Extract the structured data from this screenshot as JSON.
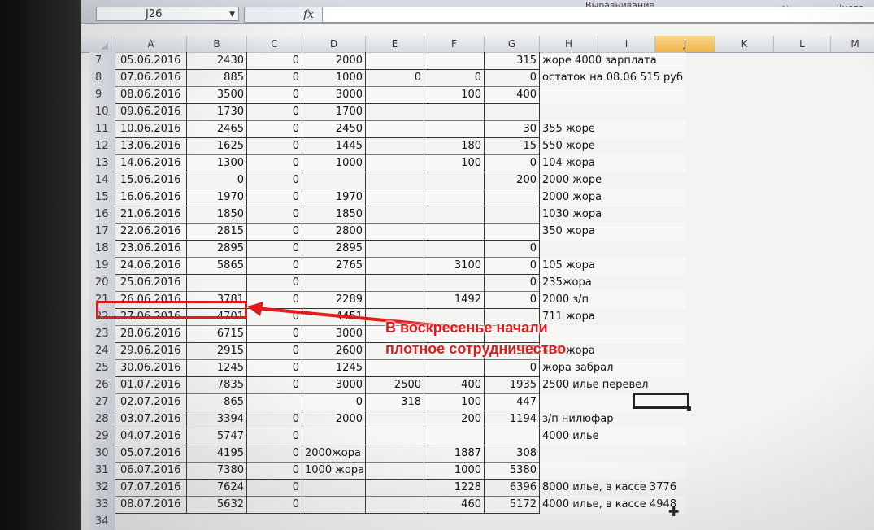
{
  "ribbon": {
    "alignment_label": "Выравнивание",
    "number_label": "Число"
  },
  "formula_bar": {
    "name_box": "J26",
    "fx_symbol": "fx",
    "formula": ""
  },
  "columns": [
    "A",
    "B",
    "C",
    "D",
    "E",
    "F",
    "G",
    "H",
    "I",
    "J",
    "K",
    "L",
    "M"
  ],
  "selected_column": "J",
  "rows": [
    {
      "num": "7",
      "A": "05.06.2016",
      "B": "2430",
      "C": "0",
      "D": "2000",
      "E": "",
      "F": "",
      "G": "315",
      "H": "жоре 4000 зарплата"
    },
    {
      "num": "8",
      "A": "07.06.2016",
      "B": "885",
      "C": "0",
      "D": "1000",
      "E": "0",
      "F": "0",
      "G": "0",
      "H": "остаток на 08.06 515 руб"
    },
    {
      "num": "9",
      "A": "08.06.2016",
      "B": "3500",
      "C": "0",
      "D": "3000",
      "E": "",
      "F": "100",
      "G": "400",
      "H": ""
    },
    {
      "num": "10",
      "A": "09.06.2016",
      "B": "1730",
      "C": "0",
      "D": "1700",
      "E": "",
      "F": "",
      "G": "",
      "H": ""
    },
    {
      "num": "11",
      "A": "10.06.2016",
      "B": "2465",
      "C": "0",
      "D": "2450",
      "E": "",
      "F": "",
      "G": "30",
      "H": "355 жоре"
    },
    {
      "num": "12",
      "A": "13.06.2016",
      "B": "1625",
      "C": "0",
      "D": "1445",
      "E": "",
      "F": "180",
      "G": "15",
      "H": "550 жоре"
    },
    {
      "num": "13",
      "A": "14.06.2016",
      "B": "1300",
      "C": "0",
      "D": "1000",
      "E": "",
      "F": "100",
      "G": "0",
      "H": "104 жора"
    },
    {
      "num": "14",
      "A": "15.06.2016",
      "B": "0",
      "C": "0",
      "D": "",
      "E": "",
      "F": "",
      "G": "200",
      "H": "2000 жоре"
    },
    {
      "num": "15",
      "A": "16.06.2016",
      "B": "1970",
      "C": "0",
      "D": "1970",
      "E": "",
      "F": "",
      "G": "",
      "H": "2000 жора"
    },
    {
      "num": "16",
      "A": "21.06.2016",
      "B": "1850",
      "C": "0",
      "D": "1850",
      "E": "",
      "F": "",
      "G": "",
      "H": "1030 жора"
    },
    {
      "num": "17",
      "A": "22.06.2016",
      "B": "2815",
      "C": "0",
      "D": "2800",
      "E": "",
      "F": "",
      "G": "",
      "H": "350 жора"
    },
    {
      "num": "18",
      "A": "23.06.2016",
      "B": "2895",
      "C": "0",
      "D": "2895",
      "E": "",
      "F": "",
      "G": "0",
      "H": ""
    },
    {
      "num": "19",
      "A": "24.06.2016",
      "B": "5865",
      "C": "0",
      "D": "2765",
      "E": "",
      "F": "3100",
      "G": "0",
      "H": "105 жора"
    },
    {
      "num": "20",
      "A": "25.06.2016",
      "B": "",
      "C": "0",
      "D": "",
      "E": "",
      "F": "",
      "G": "0",
      "H": "235жора"
    },
    {
      "num": "21",
      "A": "26.06.2016",
      "B": "3781",
      "C": "0",
      "D": "2289",
      "E": "",
      "F": "1492",
      "G": "0",
      "H": "2000 з/п"
    },
    {
      "num": "22",
      "A": "27.06.2016",
      "B": "4701",
      "C": "0",
      "D": "4451",
      "E": "",
      "F": "",
      "G": "",
      "H": "711 жора"
    },
    {
      "num": "23",
      "A": "28.06.2016",
      "B": "6715",
      "C": "0",
      "D": "3000",
      "E": "",
      "F": "",
      "G": "",
      "H": ""
    },
    {
      "num": "24",
      "A": "29.06.2016",
      "B": "2915",
      "C": "0",
      "D": "2600",
      "E": "",
      "F": "",
      "G": "315",
      "H": "400 жора"
    },
    {
      "num": "25",
      "A": "30.06.2016",
      "B": "1245",
      "C": "0",
      "D": "1245",
      "E": "",
      "F": "",
      "G": "0",
      "H": "жора забрал"
    },
    {
      "num": "26",
      "A": "01.07.2016",
      "B": "7835",
      "C": "0",
      "D": "3000",
      "E": "2500",
      "F": "400",
      "G": "1935",
      "H": "2500 илье перевел"
    },
    {
      "num": "27",
      "A": "02.07.2016",
      "B": "865",
      "C": "",
      "D": "0",
      "E": "318",
      "F": "100",
      "G": "447",
      "H": ""
    },
    {
      "num": "28",
      "A": "03.07.2016",
      "B": "3394",
      "C": "0",
      "D": "2000",
      "E": "",
      "F": "200",
      "G": "1194",
      "H": "з/п нилюфар"
    },
    {
      "num": "29",
      "A": "04.07.2016",
      "B": "5747",
      "C": "0",
      "D": "",
      "E": "",
      "F": "",
      "G": "",
      "H": "4000 илье"
    },
    {
      "num": "30",
      "A": "05.07.2016",
      "B": "4195",
      "C": "0",
      "D": "2000жора",
      "E": "",
      "F": "1887",
      "G": "308",
      "H": ""
    },
    {
      "num": "31",
      "A": "06.07.2016",
      "B": "7380",
      "C": "0",
      "D": "1000 жора",
      "E": "",
      "F": "1000",
      "G": "5380",
      "H": ""
    },
    {
      "num": "32",
      "A": "07.07.2016",
      "B": "7624",
      "C": "0",
      "D": "",
      "E": "",
      "F": "1228",
      "G": "6396",
      "H": "8000 илье, в кассе 3776"
    },
    {
      "num": "33",
      "A": "08.07.2016",
      "B": "5632",
      "C": "0",
      "D": "",
      "E": "",
      "F": "460",
      "G": "5172",
      "H": "4000 илье, в кассе 4948"
    },
    {
      "num": "34",
      "A": "",
      "B": "",
      "C": "",
      "D": "",
      "E": "",
      "F": "",
      "G": "",
      "H": ""
    }
  ],
  "annotation": {
    "line1": "В воскресенье начали",
    "line2": "плотное сотрудничество",
    "color": "#e01b1b",
    "highlighted_row": "21"
  }
}
